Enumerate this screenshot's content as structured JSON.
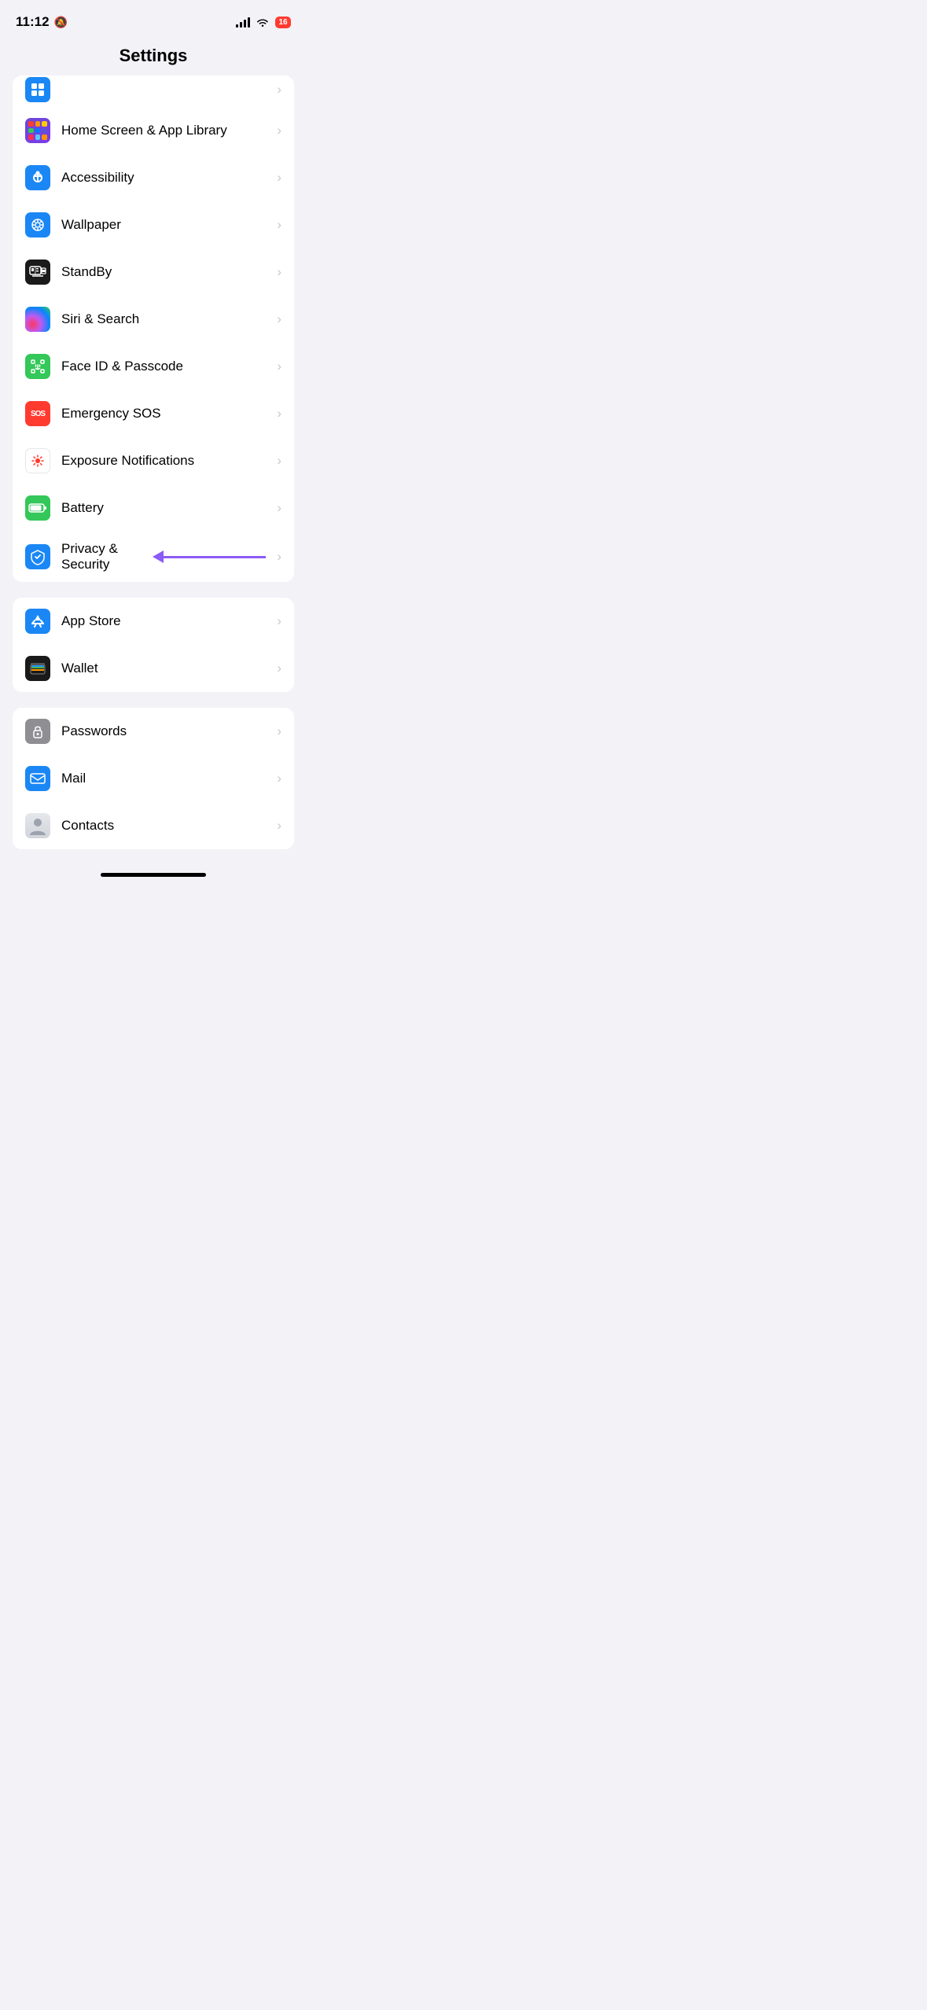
{
  "status_bar": {
    "time": "11:12",
    "mute_icon": "🔕",
    "battery_level": "16"
  },
  "header": {
    "title": "Settings"
  },
  "sections": [
    {
      "id": "system-top",
      "items": [
        {
          "id": "home-screen",
          "label": "Home Screen & App Library",
          "icon_type": "home-screen",
          "has_chevron": true
        },
        {
          "id": "accessibility",
          "label": "Accessibility",
          "icon_type": "accessibility",
          "has_chevron": true
        },
        {
          "id": "wallpaper",
          "label": "Wallpaper",
          "icon_type": "wallpaper",
          "has_chevron": true
        },
        {
          "id": "standby",
          "label": "StandBy",
          "icon_type": "standby",
          "has_chevron": true
        },
        {
          "id": "siri-search",
          "label": "Siri & Search",
          "icon_type": "siri",
          "has_chevron": true
        },
        {
          "id": "face-id",
          "label": "Face ID & Passcode",
          "icon_type": "faceid",
          "has_chevron": true
        },
        {
          "id": "emergency-sos",
          "label": "Emergency SOS",
          "icon_type": "sos",
          "has_chevron": true
        },
        {
          "id": "exposure",
          "label": "Exposure Notifications",
          "icon_type": "exposure",
          "has_chevron": true
        },
        {
          "id": "battery",
          "label": "Battery",
          "icon_type": "battery",
          "has_chevron": true
        },
        {
          "id": "privacy",
          "label": "Privacy & Security",
          "icon_type": "privacy",
          "has_chevron": true,
          "has_annotation": true
        }
      ]
    },
    {
      "id": "apps-section",
      "items": [
        {
          "id": "app-store",
          "label": "App Store",
          "icon_type": "appstore",
          "has_chevron": true
        },
        {
          "id": "wallet",
          "label": "Wallet",
          "icon_type": "wallet",
          "has_chevron": true
        }
      ]
    },
    {
      "id": "apps-section-2",
      "items": [
        {
          "id": "passwords",
          "label": "Passwords",
          "icon_type": "passwords",
          "has_chevron": true
        },
        {
          "id": "mail",
          "label": "Mail",
          "icon_type": "mail",
          "has_chevron": true
        },
        {
          "id": "contacts",
          "label": "Contacts",
          "icon_type": "contacts",
          "has_chevron": true
        }
      ]
    }
  ],
  "chevron": "›",
  "home_bar": "home-bar"
}
